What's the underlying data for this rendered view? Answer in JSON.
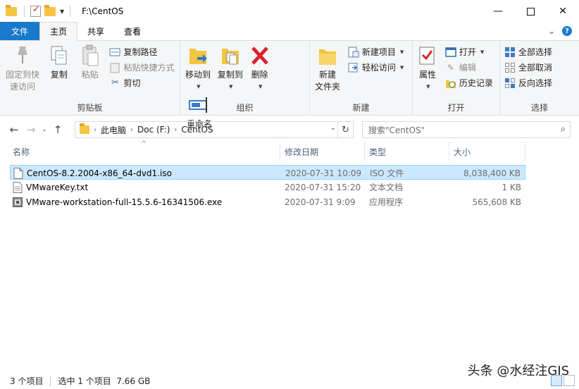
{
  "window": {
    "title": "F:\\CentOS"
  },
  "tabs": {
    "file": "文件",
    "home": "主页",
    "share": "共享",
    "view": "查看"
  },
  "ribbon": {
    "clipboard": {
      "label": "剪贴板",
      "pin_line1": "固定到快",
      "pin_line2": "速访问",
      "copy": "复制",
      "paste": "粘贴",
      "copy_path": "复制路径",
      "paste_shortcut": "粘贴快捷方式",
      "cut": "剪切"
    },
    "organize": {
      "label": "组织",
      "move_to": "移动到",
      "copy_to": "复制到",
      "delete": "删除",
      "rename": "重命名"
    },
    "new": {
      "label": "新建",
      "new_folder_line1": "新建",
      "new_folder_line2": "文件夹",
      "new_item": "新建项目",
      "easy_access": "轻松访问"
    },
    "open": {
      "label": "打开",
      "properties": "属性",
      "open": "打开",
      "edit": "编辑",
      "history": "历史记录"
    },
    "select": {
      "label": "选择",
      "select_all": "全部选择",
      "select_none": "全部取消",
      "invert": "反向选择"
    }
  },
  "address": {
    "crumbs": [
      "此电脑",
      "Doc (F:)",
      "CentOS"
    ],
    "search_placeholder": "搜索\"CentOS\""
  },
  "columns": {
    "name": "名称",
    "date": "修改日期",
    "type": "类型",
    "size": "大小"
  },
  "files": [
    {
      "name": "CentOS-8.2.2004-x86_64-dvd1.iso",
      "date": "2020-07-31 10:09",
      "type": "ISO 文件",
      "size": "8,038,400 KB",
      "selected": true,
      "icon": "iso-file-icon"
    },
    {
      "name": "VMwareKey.txt",
      "date": "2020-07-31 15:20",
      "type": "文本文档",
      "size": "1 KB",
      "selected": false,
      "icon": "text-file-icon"
    },
    {
      "name": "VMware-workstation-full-15.5.6-16341506.exe",
      "date": "2020-07-31 9:09",
      "type": "应用程序",
      "size": "565,608 KB",
      "selected": false,
      "icon": "exe-file-icon"
    }
  ],
  "status": {
    "count": "3 个项目",
    "selection": "选中 1 个项目  7.66 GB"
  },
  "watermark": "头条 @水经注GIS",
  "colors": {
    "accent": "#1979ca",
    "selected_bg": "#cce8ff",
    "ribbon_bg": "#f5f6f7"
  }
}
